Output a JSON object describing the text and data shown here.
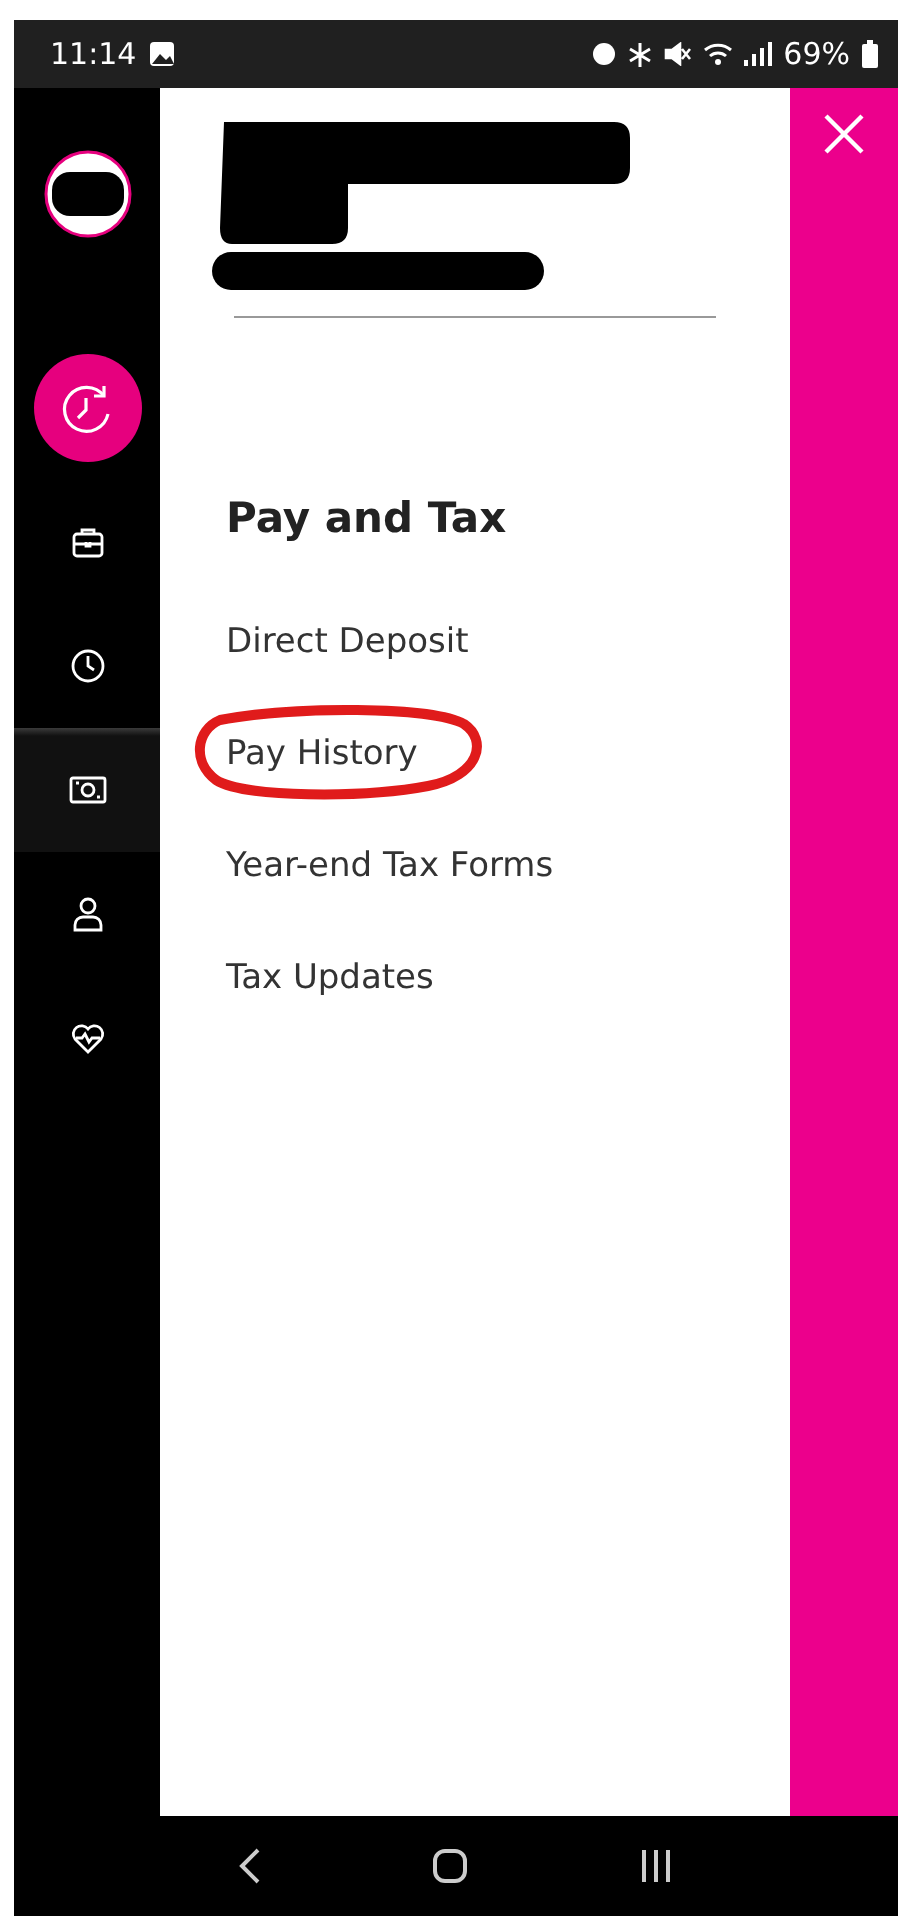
{
  "status_bar": {
    "time": "11:14",
    "battery": "69%"
  },
  "sidebar": {
    "items": [
      {
        "kind": "accent",
        "selected": false
      },
      {
        "kind": "plain",
        "selected": false
      },
      {
        "kind": "plain",
        "selected": false
      },
      {
        "kind": "plain",
        "selected": true
      },
      {
        "kind": "plain",
        "selected": false
      },
      {
        "kind": "plain",
        "selected": false
      }
    ]
  },
  "menu": {
    "heading": "Pay and Tax",
    "items": [
      {
        "label": "Direct Deposit",
        "circled": false
      },
      {
        "label": "Pay History",
        "circled": true
      },
      {
        "label": "Year-end Tax Forms",
        "circled": false
      },
      {
        "label": "Tax Updates",
        "circled": false
      }
    ]
  }
}
